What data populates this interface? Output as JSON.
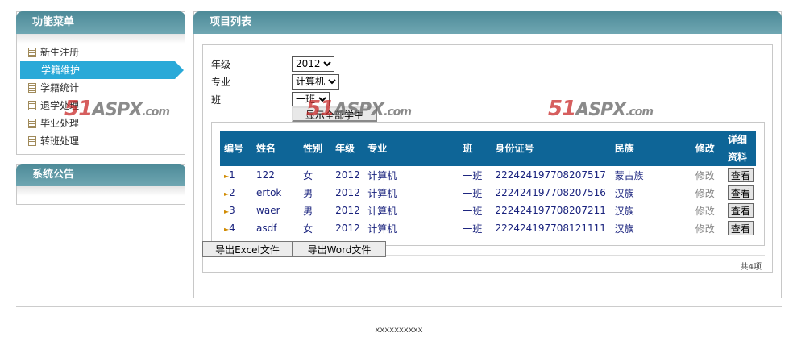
{
  "sidebar": {
    "menu_title": "功能菜单",
    "items": [
      {
        "label": "新生注册"
      },
      {
        "label": "学籍维护"
      },
      {
        "label": "学籍统计"
      },
      {
        "label": "退学处理"
      },
      {
        "label": "毕业处理"
      },
      {
        "label": "转班处理"
      }
    ],
    "notice_title": "系统公告"
  },
  "main": {
    "title": "项目列表",
    "filters": {
      "grade_label": "年级",
      "grade_value": "2012",
      "major_label": "专业",
      "major_value": "计算机",
      "class_label": "班",
      "class_value": "一班",
      "show_all": "显示全部学生"
    },
    "table": {
      "headers": [
        "编号",
        "姓名",
        "性别",
        "年级",
        "专业",
        "班",
        "身份证号",
        "民族",
        "修改",
        "详细资料"
      ],
      "rows": [
        [
          "1",
          "122",
          "女",
          "2012",
          "计算机",
          "一班",
          "222424197708207517",
          "蒙古族",
          "修改",
          "查看"
        ],
        [
          "2",
          "ertok",
          "男",
          "2012",
          "计算机",
          "一班",
          "222424197708207516",
          "汉族",
          "修改",
          "查看"
        ],
        [
          "3",
          "waer",
          "男",
          "2012",
          "计算机",
          "一班",
          "222424197708207211",
          "汉族",
          "修改",
          "查看"
        ],
        [
          "4",
          "asdf",
          "女",
          "2012",
          "计算机",
          "一班",
          "222424197708121111",
          "汉族",
          "修改",
          "查看"
        ]
      ]
    },
    "pager": "共4项",
    "export_excel": "导出Excel文件",
    "export_word": "导出Word文件"
  },
  "footer": "xxxxxxxxxx",
  "watermark": "51aspx.com"
}
